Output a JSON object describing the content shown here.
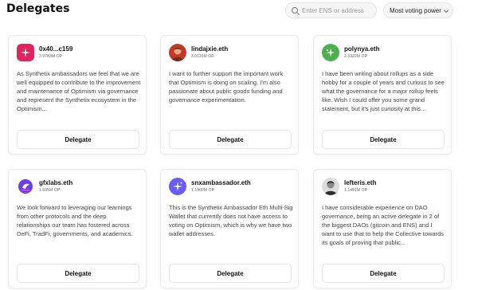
{
  "header": {
    "title": "Delegates",
    "search_placeholder": "Enter ENS or address",
    "sort_label": "Most voting power"
  },
  "delegate_button_label": "Delegate",
  "delegates": [
    {
      "name": "0x40...c159",
      "votes": "3.9783M OP",
      "bio": "As Synthetix ambassadors we feel that we are well equipped to contribute to the improvement and maintenance of Optimism via governance and represent the Synthetix ecosystem in the Optimism...",
      "avatar_color": "#e0245e"
    },
    {
      "name": "lindajxie.eth",
      "votes": "3.0116M OP",
      "bio": "I want to further support the important work that Optimism is doing on scaling. I'm also passionate about public goods funding and governance experimentation.",
      "avatar_color": "#c0392b"
    },
    {
      "name": "polynya.eth",
      "votes": "2.3322M OP",
      "bio": "I have been writing about rollups as a side hobby for a couple of years and curious to see what the governance for a major rollup feels like. Wish I could offer you some grand statement, but it's just curiosity at this...",
      "avatar_color": "#4caf50"
    },
    {
      "name": "gfxlabs.eth",
      "votes": "1.535M OP",
      "bio": "We look forward to leveraging our learnings from other protocols and the deep relationships our team has fostered across DeFi, TradFi, governments, and academics.",
      "avatar_color": "#6a3df0"
    },
    {
      "name": "snxambassador.eth",
      "votes": "1.1902M OP",
      "bio": "This is the Synthetix Ambassador Eth Multi-Sig Wallet that currently does not have access to voting on Optimism, which is why we have two wallet addresses.",
      "avatar_color": "#6b5cf5"
    },
    {
      "name": "lefteris.eth",
      "votes": "1.1491M OP",
      "bio": "I have considerable experience on DAO governance, being an active delegate in 2 of the biggest DAOs (gitcoin and ENS) and I want to use that to help the Collective towards its goals of proving that public...",
      "avatar_color": "#2c2c2c"
    }
  ]
}
